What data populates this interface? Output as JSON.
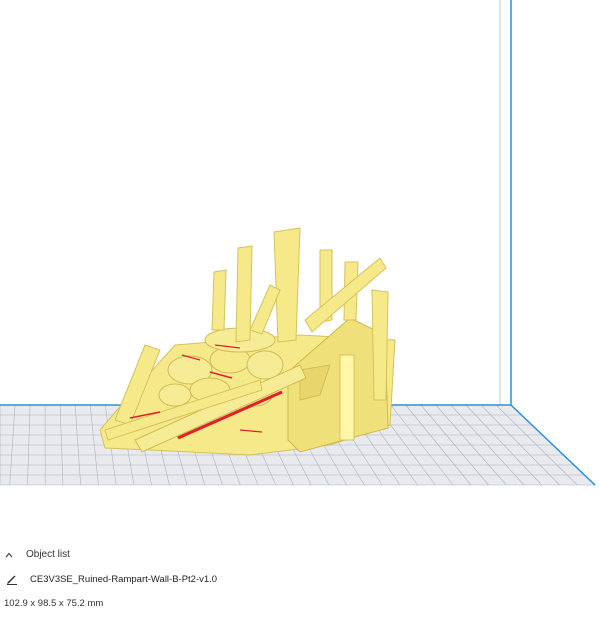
{
  "object_panel": {
    "header_label": "Object list",
    "file_name": "CE3V3SE_Ruined-Rampart-Wall-B-Pt2-v1.0",
    "dimensions": "102.9 x 98.5 x 75.2 mm"
  },
  "icons": {
    "collapse": "chevron-up-icon",
    "edit": "pencil-icon"
  },
  "colors": {
    "build_volume_line": "#2a8fd8",
    "grid_line": "#aab3c0",
    "bed": "#e9eaee",
    "model": "#f5e98a",
    "model_shade": "#d6c25a",
    "overhang": "#e0202a"
  }
}
